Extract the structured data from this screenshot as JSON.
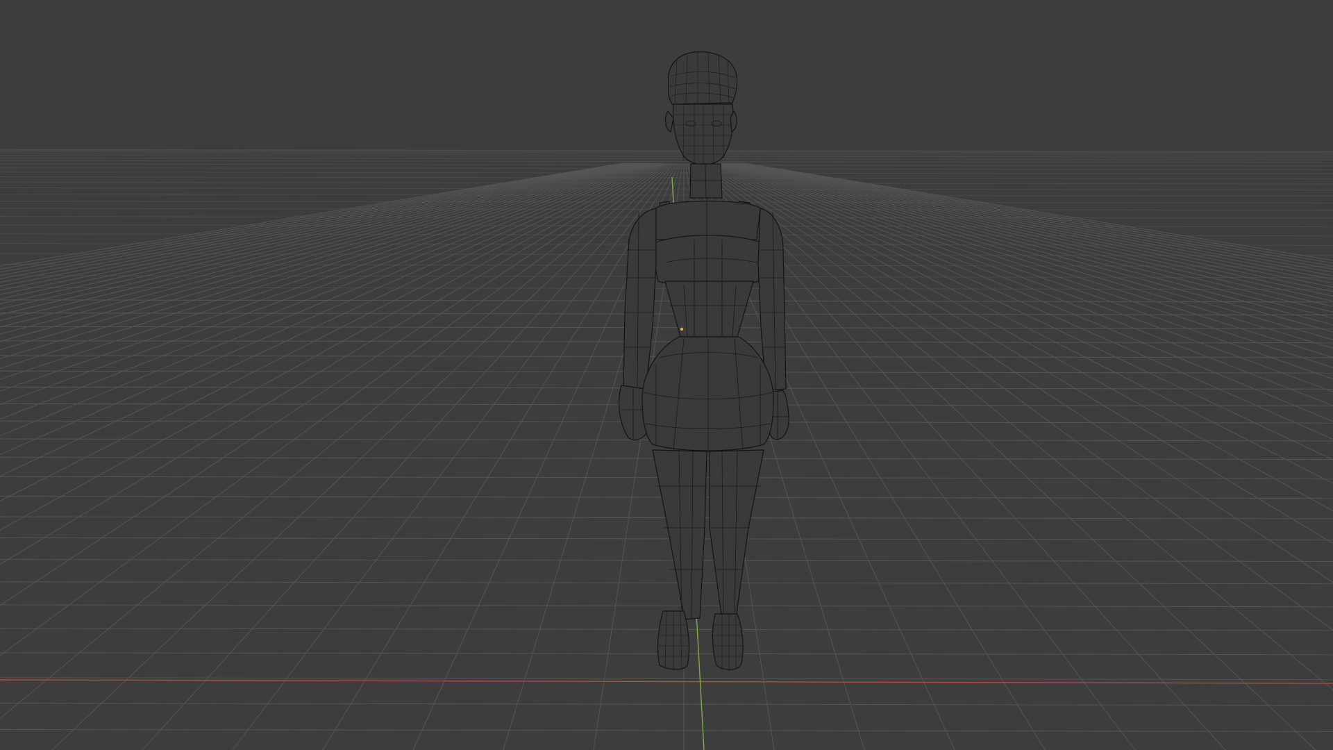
{
  "viewport": {
    "shading_mode": "wireframe",
    "background_color": "#3d3d3d",
    "grid_color": "#555555",
    "x_axis_color": "#b34a4a",
    "y_axis_color": "#7fae3f",
    "wire_color": "#141414"
  },
  "scene": {
    "object": "character-mesh",
    "icons": [
      "origin-point"
    ]
  }
}
